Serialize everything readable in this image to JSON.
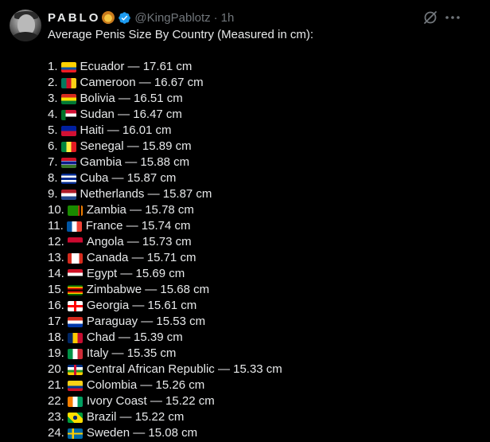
{
  "tweet": {
    "display_name": "PABLO",
    "handle": "@KingPablotz",
    "separator": "·",
    "time": "1h",
    "text_intro": "Average Penis Size By Country (Measured in cm):",
    "verified_color": "#1d9bf0"
  },
  "items": [
    {
      "rank": "1.",
      "label": "Ecuador — 17.61 cm",
      "flag": "flag-ecuador-icon"
    },
    {
      "rank": "2.",
      "label": "Cameroon — 16.67 cm",
      "flag": "flag-cameroon-icon"
    },
    {
      "rank": "3.",
      "label": "Bolivia — 16.51 cm",
      "flag": "flag-bolivia-icon"
    },
    {
      "rank": "4.",
      "label": "Sudan — 16.47 cm",
      "flag": "flag-sudan-icon"
    },
    {
      "rank": "5.",
      "label": "Haiti — 16.01 cm",
      "flag": "flag-haiti-icon"
    },
    {
      "rank": "6.",
      "label": "Senegal — 15.89 cm",
      "flag": "flag-senegal-icon"
    },
    {
      "rank": "7.",
      "label": "Gambia — 15.88 cm",
      "flag": "flag-gambia-icon"
    },
    {
      "rank": "8.",
      "label": "Cuba — 15.87 cm",
      "flag": "flag-cuba-icon"
    },
    {
      "rank": "9.",
      "label": "Netherlands — 15.87 cm",
      "flag": "flag-netherlands-icon"
    },
    {
      "rank": "10.",
      "label": "Zambia — 15.78 cm",
      "flag": "flag-zambia-icon"
    },
    {
      "rank": "11.",
      "label": "France — 15.74 cm",
      "flag": "flag-france-icon"
    },
    {
      "rank": "12.",
      "label": "Angola — 15.73 cm",
      "flag": "flag-angola-icon"
    },
    {
      "rank": "13.",
      "label": "Canada — 15.71 cm",
      "flag": "flag-canada-icon"
    },
    {
      "rank": "14.",
      "label": "Egypt — 15.69 cm",
      "flag": "flag-egypt-icon"
    },
    {
      "rank": "15.",
      "label": "Zimbabwe — 15.68 cm",
      "flag": "flag-zimbabwe-icon"
    },
    {
      "rank": "16.",
      "label": "Georgia — 15.61 cm",
      "flag": "flag-georgia-icon"
    },
    {
      "rank": "17.",
      "label": "Paraguay — 15.53 cm",
      "flag": "flag-paraguay-icon"
    },
    {
      "rank": "18.",
      "label": "Chad — 15.39 cm",
      "flag": "flag-chad-icon"
    },
    {
      "rank": "19.",
      "label": "Italy — 15.35 cm",
      "flag": "flag-italy-icon"
    },
    {
      "rank": "20.",
      "label": "Central African Republic — 15.33 cm",
      "flag": "flag-central-african-republic-icon"
    },
    {
      "rank": "21.",
      "label": "Colombia — 15.26 cm",
      "flag": "flag-colombia-icon"
    },
    {
      "rank": "22.",
      "label": "Ivory Coast — 15.22 cm",
      "flag": "flag-ivory-coast-icon"
    },
    {
      "rank": "23.",
      "label": "Brazil — 15.22 cm",
      "flag": "flag-brazil-icon"
    },
    {
      "rank": "24.",
      "label": "Sweden — 15.08 cm",
      "flag": "flag-sweden-icon"
    }
  ]
}
